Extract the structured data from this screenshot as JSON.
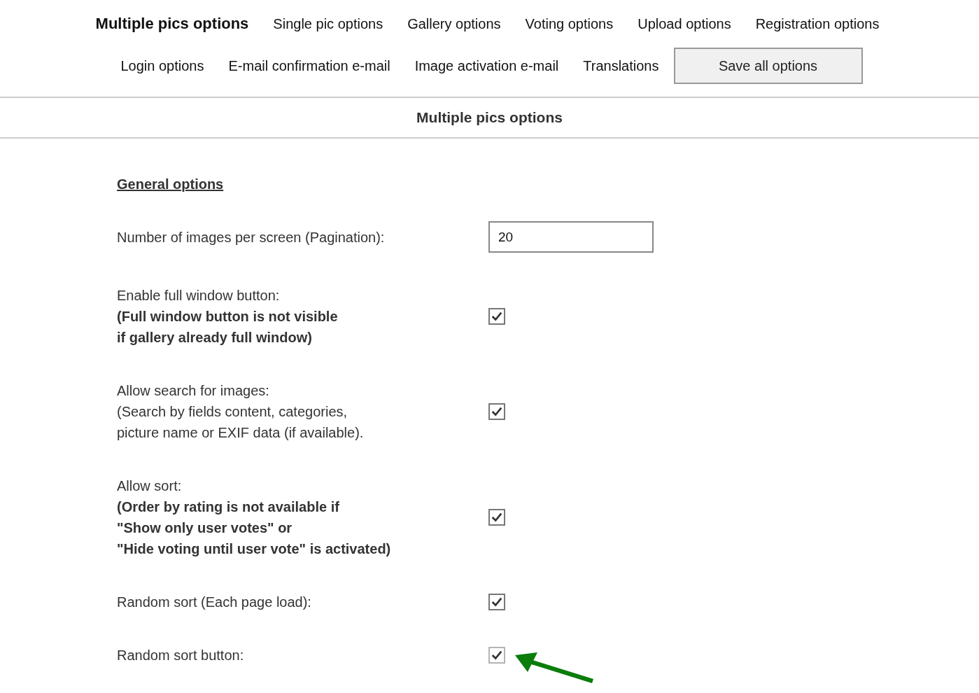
{
  "nav_rows": [
    {
      "items": [
        {
          "label": "Multiple pics options",
          "selected": true
        },
        {
          "label": "Single pic options",
          "selected": false
        },
        {
          "label": "Gallery options",
          "selected": false
        },
        {
          "label": "Voting options",
          "selected": false
        },
        {
          "label": "Upload options",
          "selected": false
        },
        {
          "label": "Registration options",
          "selected": false
        }
      ]
    },
    {
      "items": [
        {
          "label": "Login options",
          "selected": false
        },
        {
          "label": "E-mail confirmation e-mail",
          "selected": false
        },
        {
          "label": "Image activation e-mail",
          "selected": false
        },
        {
          "label": "Translations",
          "selected": false
        }
      ]
    }
  ],
  "save_button": "Save all options",
  "section_title": "Multiple pics options",
  "group_heading": "General options",
  "options": [
    {
      "kind": "number",
      "lines": [
        {
          "text": "Number of images per screen (Pagination):",
          "bold": false
        }
      ],
      "value": "20"
    },
    {
      "kind": "checkbox",
      "checked": true,
      "disabled": false,
      "lines": [
        {
          "text": "Enable full window button:",
          "bold": false
        },
        {
          "text": "(Full window button is not visible",
          "bold": true
        },
        {
          "text": "if gallery already full window)",
          "bold": true
        }
      ]
    },
    {
      "kind": "checkbox",
      "checked": true,
      "disabled": false,
      "lines": [
        {
          "text": "Allow search for images:",
          "bold": false
        },
        {
          "text": "(Search by fields content, categories,",
          "bold": false
        },
        {
          "text": "picture name or EXIF data (if available).",
          "bold": false
        }
      ]
    },
    {
      "kind": "checkbox",
      "checked": true,
      "disabled": false,
      "lines": [
        {
          "text": "Allow sort:",
          "bold": false
        },
        {
          "text": "(Order by rating is not available if",
          "bold": true
        },
        {
          "text": "\"Show only user votes\" or",
          "bold": true
        },
        {
          "text": "\"Hide voting until user vote\" is activated)",
          "bold": true
        }
      ]
    },
    {
      "kind": "checkbox",
      "checked": true,
      "disabled": false,
      "lines": [
        {
          "text": "Random sort (Each page load):",
          "bold": false
        }
      ]
    },
    {
      "kind": "checkbox",
      "checked": true,
      "disabled": true,
      "lines": [
        {
          "text": "Random sort button:",
          "bold": false
        }
      ]
    }
  ]
}
